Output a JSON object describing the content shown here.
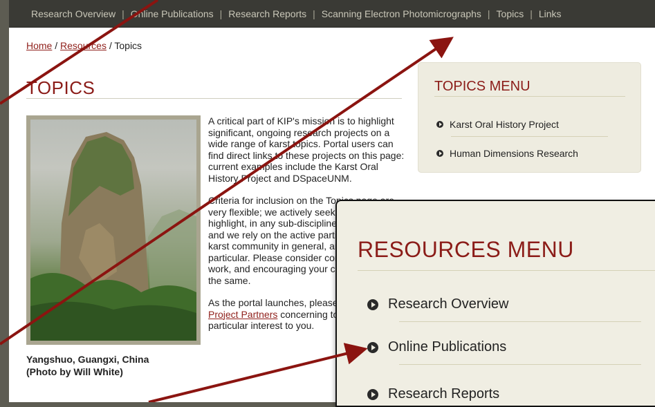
{
  "topnav": {
    "items": [
      "Research Overview",
      "Online Publications",
      "Research Reports",
      "Scanning Electron Photomicrographs",
      "Topics",
      "Links"
    ],
    "separator": "|"
  },
  "breadcrumb": {
    "home": "Home",
    "sep1": " / ",
    "resources": "Resources",
    "sep2": " / ",
    "current": "Topics"
  },
  "page": {
    "title": "TOPICS",
    "paragraphs": [
      "A critical part of KIP's mission is to highlight significant, ongoing research projects on a wide range of karst topics. Portal users can find direct links to these projects on this page: current examples include the Karst Oral History Project and DSpaceUNM.",
      "Criteria for inclusion on the Topics page are very flexible; we actively seek out work to highlight, in any sub-discipline of karst studies and we rely on the active participation of the karst community in general, and KIP users in particular. Please consider contributing your work, and encouraging your colleagues to do the same."
    ],
    "para3_lead": "As the portal launches, please contact",
    "para3_link": "the Project Partners",
    "para3_tail": "concerning topics that are of particular interest to you."
  },
  "photo": {
    "caption_line1": "Yangshuo, Guangxi, China",
    "caption_line2": "(Photo by Will White)"
  },
  "topics_menu": {
    "title": "TOPICS MENU",
    "items": [
      "Karst Oral History Project",
      "Human Dimensions Research"
    ]
  },
  "resources_menu": {
    "title": "RESOURCES MENU",
    "items": [
      "Research Overview",
      "Online Publications",
      "Research Reports"
    ]
  },
  "colors": {
    "accent": "#8b1c18",
    "nav_background": "#3a3a35",
    "box_background": "#eeece0",
    "arrow": "#8b1410"
  }
}
